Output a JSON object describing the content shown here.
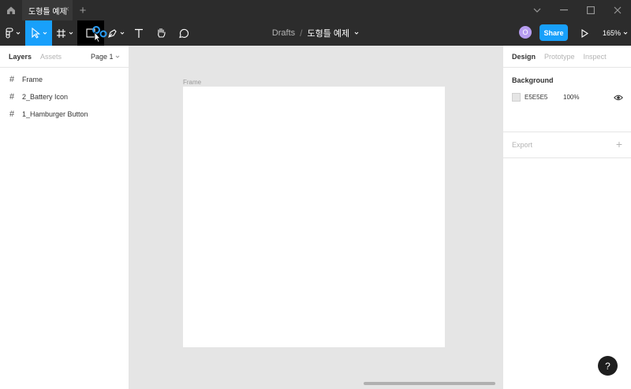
{
  "tabbar": {
    "tab_title": "도형틀 예제",
    "tab_close": "×",
    "new_tab": "+"
  },
  "toolbar": {
    "tools": [
      {
        "name": "figma-menu",
        "icon": "figma-logo-icon"
      },
      {
        "name": "move-tool",
        "icon": "cursor-icon",
        "active": true
      },
      {
        "name": "frame-tool",
        "icon": "hash-icon"
      },
      {
        "name": "shape-tool",
        "icon": "rectangle-icon"
      },
      {
        "name": "pen-tool",
        "icon": "pen-icon"
      },
      {
        "name": "text-tool",
        "icon": "text-icon"
      },
      {
        "name": "hand-tool",
        "icon": "hand-icon"
      },
      {
        "name": "comment-tool",
        "icon": "comment-icon"
      }
    ],
    "breadcrumb": {
      "folder": "Drafts",
      "separator": "/",
      "file": "도형틀 예제"
    },
    "avatar_initial": "O",
    "share_label": "Share",
    "zoom_label": "165%"
  },
  "left_panel": {
    "tabs": [
      "Layers",
      "Assets"
    ],
    "page_selector": "Page 1",
    "layers": [
      {
        "name": "Frame"
      },
      {
        "name": "2_Battery Icon"
      },
      {
        "name": "1_Hamburger Button"
      }
    ]
  },
  "canvas": {
    "frame_label": "Frame"
  },
  "right_panel": {
    "tabs": [
      "Design",
      "Prototype",
      "Inspect"
    ],
    "background": {
      "title": "Background",
      "hex": "E5E5E5",
      "opacity": "100%",
      "swatch_color": "#E5E5E5"
    },
    "export": {
      "title": "Export",
      "add": "+"
    }
  },
  "help": "?",
  "colors": {
    "accent": "#18A0FB",
    "toolbar_bg": "#2C2C2C",
    "canvas_bg": "#E5E5E5"
  }
}
